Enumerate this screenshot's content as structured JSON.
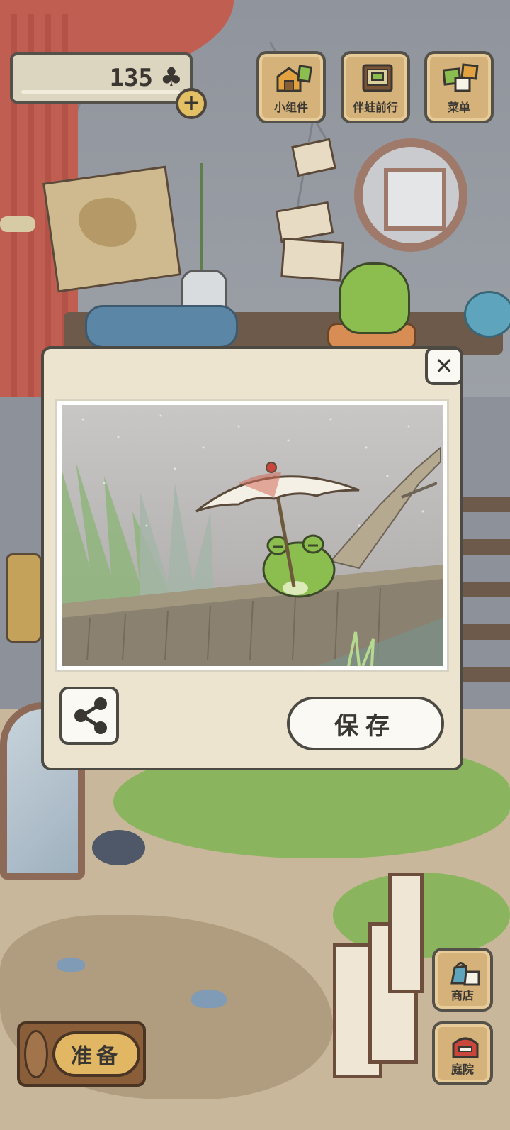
{
  "hud": {
    "clover_count": "135",
    "clover_icon": "clover-icon",
    "add_label": "+"
  },
  "top_menu": [
    {
      "label": "小组件",
      "icon": "widget-icon"
    },
    {
      "label": "伴蛙前行",
      "icon": "album-icon"
    },
    {
      "label": "菜单",
      "icon": "menu-icon"
    }
  ],
  "side_menu": [
    {
      "label": "商店",
      "icon": "shop-bag-icon"
    },
    {
      "label": "庭院",
      "icon": "mailbox-icon"
    }
  ],
  "prepare_button": {
    "label": "准备"
  },
  "photo_dialog": {
    "close_label": "✕",
    "save_label": "保存",
    "share_icon": "share-icon",
    "photo_subject": "frog-with-umbrella-in-rain"
  },
  "colors": {
    "panel": "#ece4cf",
    "border": "#4d4943",
    "wood": "#d5b27a",
    "frog_green": "#8bbd4f"
  }
}
